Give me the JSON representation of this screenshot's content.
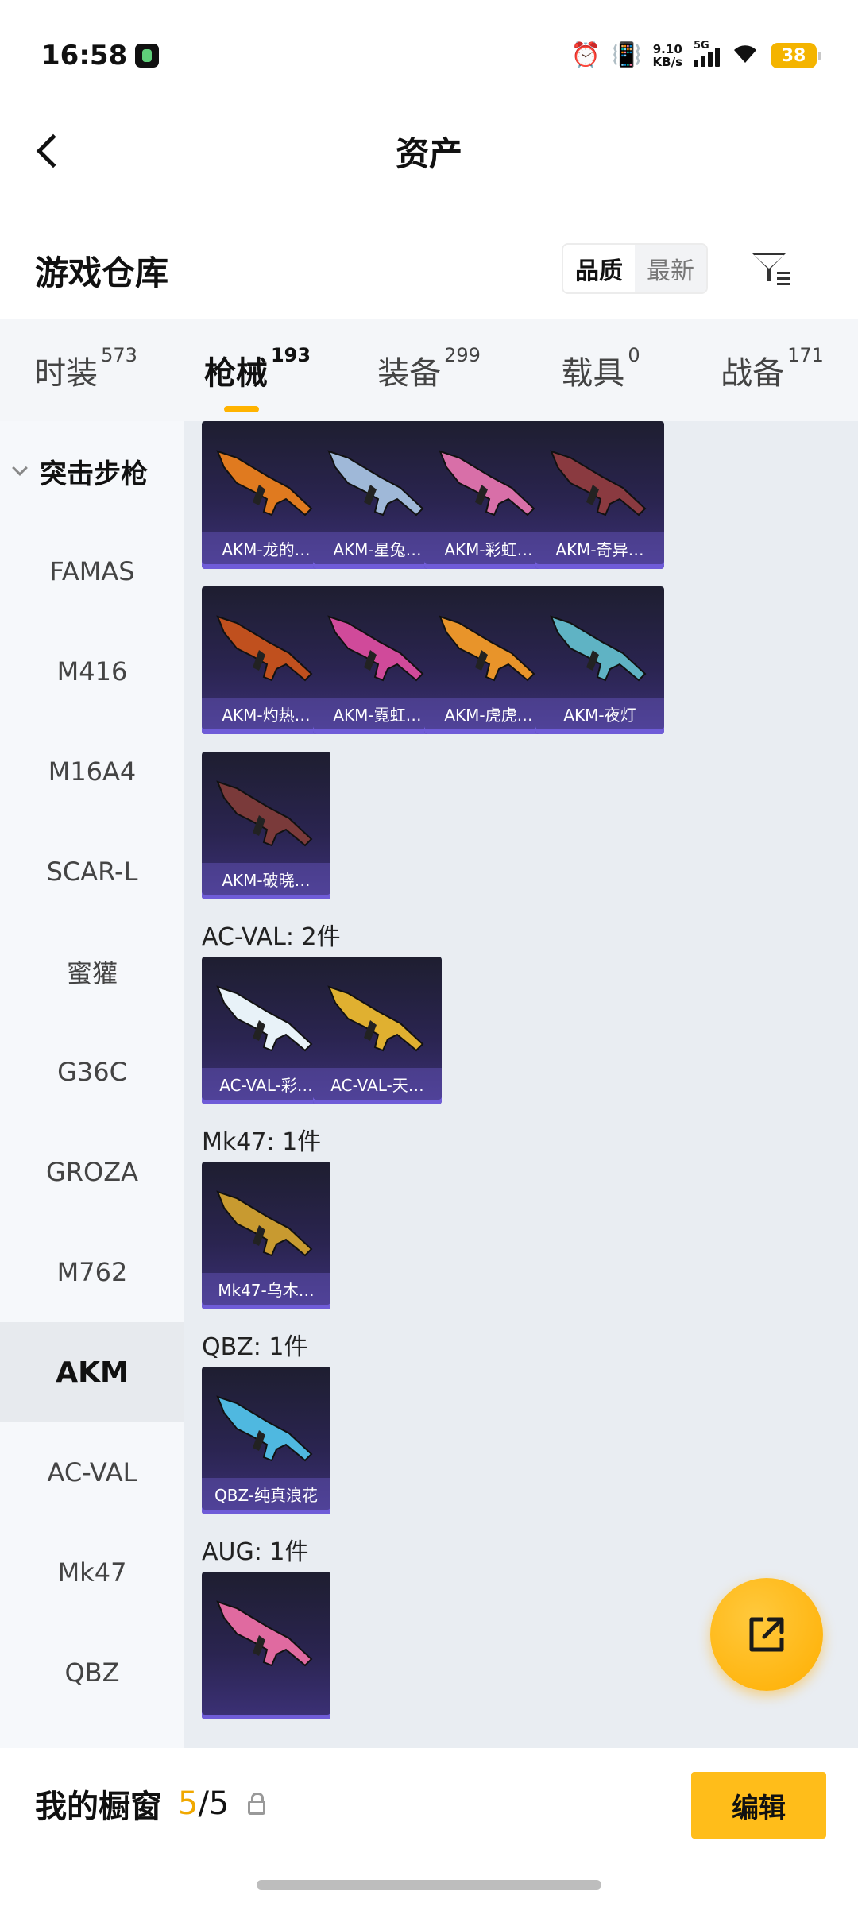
{
  "status_bar": {
    "time": "16:58",
    "net_speed_value": "9.10",
    "net_speed_unit": "KB/s",
    "network": "5G",
    "battery": "38"
  },
  "header": {
    "title": "资产"
  },
  "warehouse": {
    "title": "游戏仓库",
    "sort_options": [
      "品质",
      "最新"
    ],
    "sort_active": "品质"
  },
  "tabs": [
    {
      "label": "时装",
      "count": "573"
    },
    {
      "label": "枪械",
      "count": "193",
      "active": true
    },
    {
      "label": "装备",
      "count": "299"
    },
    {
      "label": "载具",
      "count": "0"
    },
    {
      "label": "战备",
      "count": "171"
    }
  ],
  "sidebar": {
    "group": "突击步枪",
    "items": [
      "FAMAS",
      "M416",
      "M16A4",
      "SCAR-L",
      "蜜獾",
      "G36C",
      "GROZA",
      "M762",
      "AKM",
      "AC-VAL",
      "Mk47",
      "QBZ"
    ],
    "active": "AKM"
  },
  "sections": [
    {
      "title": "",
      "items": [
        "AKM-龙的…",
        "AKM-星兔…",
        "AKM-彩虹…",
        "AKM-奇异…",
        "AKM-灼热…",
        "AKM-霓虹…",
        "AKM-虎虎…",
        "AKM-夜灯",
        "AKM-破晓…"
      ]
    },
    {
      "title": "AC-VAL: 2件",
      "items": [
        "AC-VAL-彩…",
        "AC-VAL-天…"
      ]
    },
    {
      "title": "Mk47: 1件",
      "items": [
        "Mk47-乌木…"
      ]
    },
    {
      "title": "QBZ: 1件",
      "items": [
        "QBZ-纯真浪花"
      ]
    },
    {
      "title": "AUG: 1件",
      "items": []
    }
  ],
  "skin_colors": [
    "#e07a1f",
    "#9fb8d8",
    "#d86fa8",
    "#8a3a40",
    "#c0501e",
    "#d04a9a",
    "#e8942a",
    "#5fb3c4",
    "#7a3a3a",
    "#e8f2f8",
    "#e0b030",
    "#c89a30",
    "#4fb8e0",
    "#e06aa0"
  ],
  "bottom_bar": {
    "label": "我的橱窗",
    "count_used": "5",
    "count_sep_total": "/5",
    "edit_label": "编辑"
  },
  "icons": {
    "back": "chevron-left-icon",
    "filter": "filter-icon",
    "fab": "external-link-icon",
    "lock": "lock-icon"
  }
}
